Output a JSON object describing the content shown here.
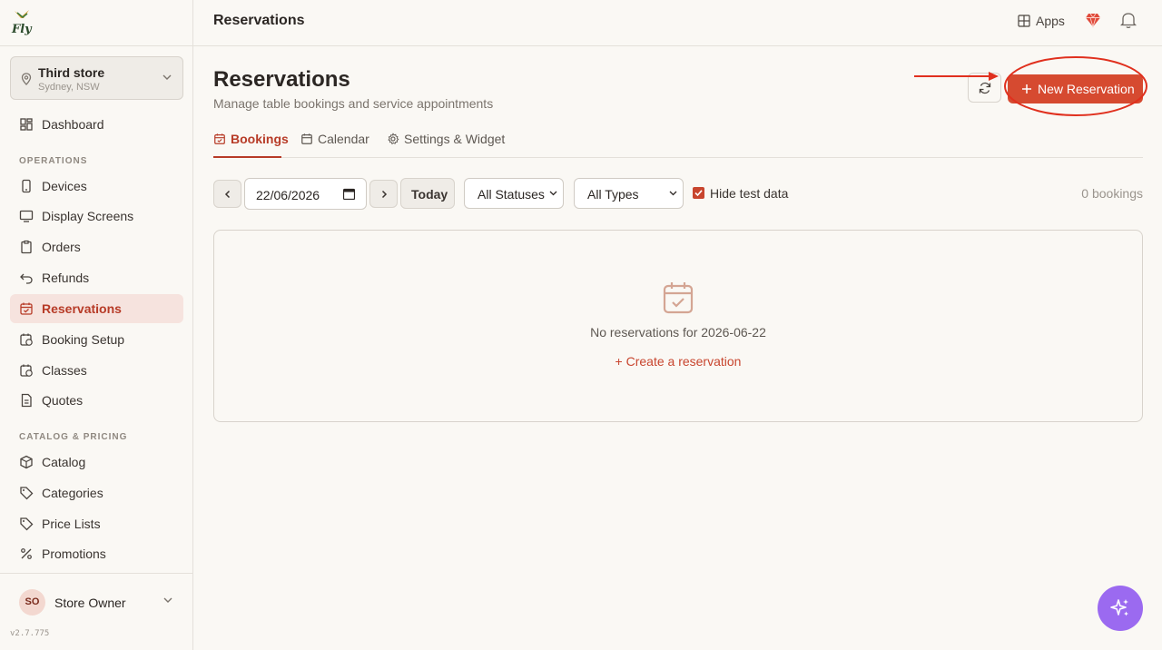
{
  "brand": {
    "logo_text": "Fly"
  },
  "store": {
    "name": "Third store",
    "location": "Sydney, NSW"
  },
  "sidebar": {
    "items_top": [
      {
        "label": "Dashboard"
      }
    ],
    "operations": {
      "title": "OPERATIONS",
      "items": [
        {
          "label": "Devices"
        },
        {
          "label": "Display Screens"
        },
        {
          "label": "Orders"
        },
        {
          "label": "Refunds"
        },
        {
          "label": "Reservations"
        },
        {
          "label": "Booking Setup"
        },
        {
          "label": "Classes"
        },
        {
          "label": "Quotes"
        }
      ]
    },
    "catalog": {
      "title": "CATALOG & PRICING",
      "items": [
        {
          "label": "Catalog"
        },
        {
          "label": "Categories"
        },
        {
          "label": "Price Lists"
        },
        {
          "label": "Promotions"
        }
      ]
    },
    "active_item": "Reservations"
  },
  "user": {
    "initials": "SO",
    "name": "Store Owner"
  },
  "version": "v2.7.775",
  "topbar": {
    "title": "Reservations",
    "apps_label": "Apps"
  },
  "page": {
    "title": "Reservations",
    "subtitle": "Manage table bookings and service appointments",
    "new_button": "New Reservation"
  },
  "tabs": [
    {
      "label": "Bookings",
      "active": true
    },
    {
      "label": "Calendar",
      "active": false
    },
    {
      "label": "Settings & Widget",
      "active": false
    }
  ],
  "filters": {
    "date": "22/06/2026",
    "today_label": "Today",
    "status_select": "All Statuses",
    "type_select": "All Types",
    "hide_test_label": "Hide test data",
    "hide_test_checked": true,
    "count_text": "0 bookings"
  },
  "empty_state": {
    "message": "No reservations for 2026-06-22",
    "create_link": "+ Create a reservation"
  },
  "colors": {
    "accent": "#d64a30",
    "active_bg": "#f6e3de",
    "fab": "#9b6af0",
    "annotation": "#e0301e"
  }
}
